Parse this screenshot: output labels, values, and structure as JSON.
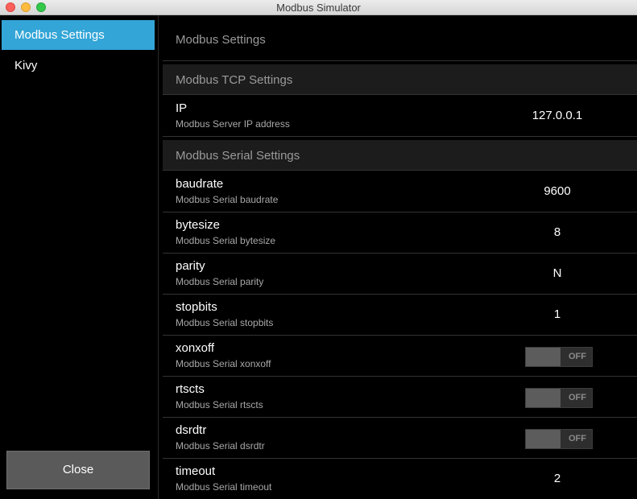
{
  "window": {
    "title": "Modbus Simulator"
  },
  "sidebar": {
    "items": [
      {
        "label": "Modbus Settings",
        "active": true
      },
      {
        "label": "Kivy",
        "active": false
      }
    ],
    "close_label": "Close"
  },
  "main": {
    "title": "Modbus Settings",
    "sections": [
      {
        "title": "Modbus TCP Settings"
      },
      {
        "title": "Modbus Serial Settings"
      }
    ],
    "settings": {
      "ip": {
        "name": "IP",
        "desc": "Modbus Server IP address",
        "value": "127.0.0.1"
      },
      "baudrate": {
        "name": "baudrate",
        "desc": "Modbus Serial baudrate",
        "value": "9600"
      },
      "bytesize": {
        "name": "bytesize",
        "desc": "Modbus Serial bytesize",
        "value": "8"
      },
      "parity": {
        "name": "parity",
        "desc": "Modbus Serial parity",
        "value": "N"
      },
      "stopbits": {
        "name": "stopbits",
        "desc": "Modbus Serial stopbits",
        "value": "1"
      },
      "xonxoff": {
        "name": "xonxoff",
        "desc": "Modbus Serial xonxoff",
        "state": "OFF"
      },
      "rtscts": {
        "name": "rtscts",
        "desc": "Modbus Serial rtscts",
        "state": "OFF"
      },
      "dsrdtr": {
        "name": "dsrdtr",
        "desc": "Modbus Serial dsrdtr",
        "state": "OFF"
      },
      "timeout": {
        "name": "timeout",
        "desc": "Modbus Serial timeout",
        "value": "2"
      }
    }
  },
  "colors": {
    "accent": "#33a5d7",
    "background": "#000000",
    "section": "#1c1c1c"
  }
}
